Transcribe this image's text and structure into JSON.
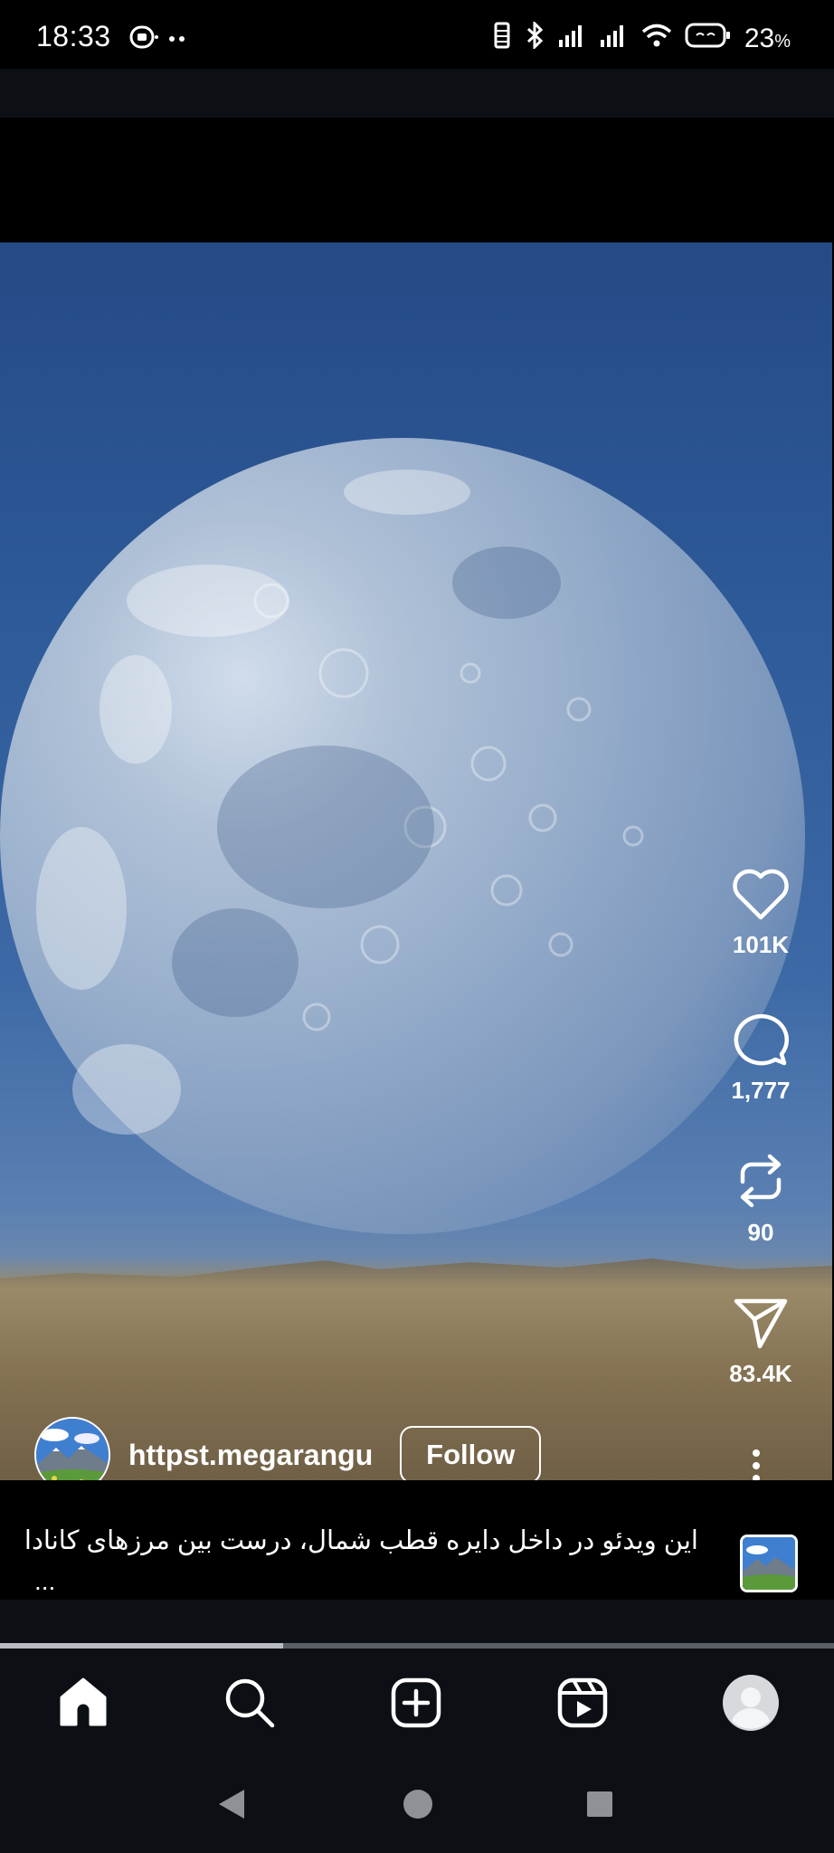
{
  "status_bar": {
    "time": "18:33",
    "battery": "23",
    "battery_unit": "%"
  },
  "post": {
    "username": "httpst.megarangu",
    "follow_label": "Follow",
    "caption": "این ویدئو در داخل دایره قطب شمال، درست بین مرزهای کانادا",
    "caption_more": "...",
    "likes": "101K",
    "comments": "1,777",
    "reposts": "90",
    "shares": "83.4K",
    "progress_fraction": 0.34
  },
  "bottom_nav": {
    "items": [
      "home-icon",
      "search-icon",
      "create-icon",
      "reels-icon",
      "profile-avatar"
    ],
    "active": "home"
  },
  "colors": {
    "background": "#000000",
    "nav_bg": "#0c1014",
    "text": "#ffffff",
    "progress_fill": "#b8bcc2",
    "progress_track": "#5a5f66"
  }
}
